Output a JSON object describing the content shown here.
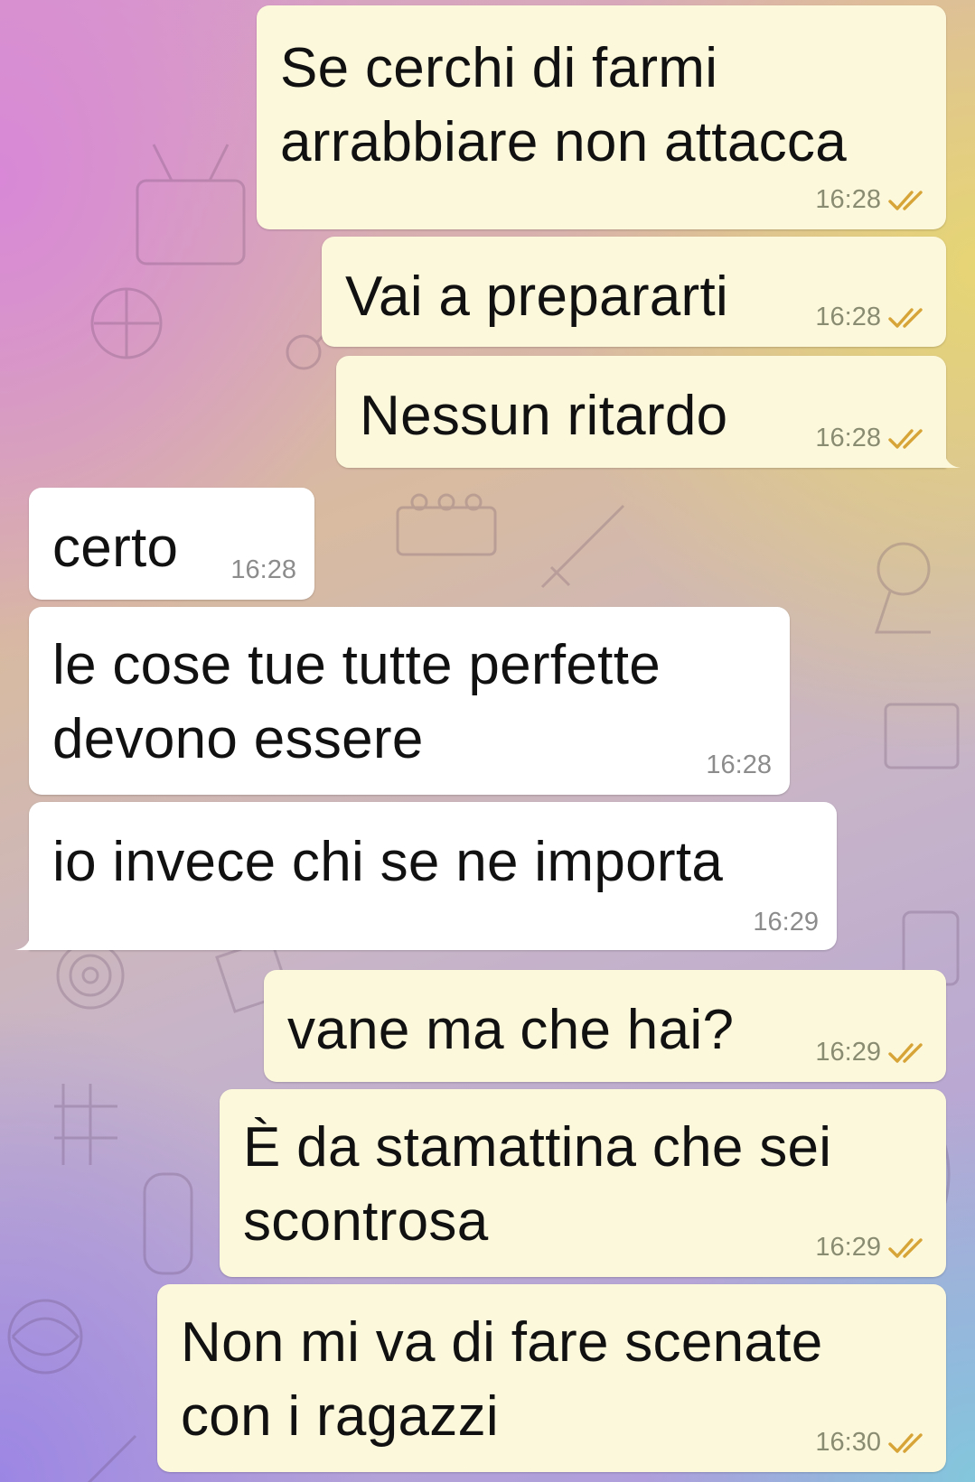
{
  "colors": {
    "outgoing_bubble": "#fcf8dc",
    "incoming_bubble": "#ffffff",
    "check_color": "#d6a437",
    "text_color": "#111111"
  },
  "icons": {
    "read_receipt": "double-check-icon"
  },
  "messages": [
    {
      "direction": "outgoing",
      "lines": [
        "Se cerchi di farmi",
        "arrabbiare non attacca"
      ],
      "time": "16:28",
      "status": "read"
    },
    {
      "direction": "outgoing",
      "lines": [
        "Vai a prepararti"
      ],
      "time": "16:28",
      "status": "read"
    },
    {
      "direction": "outgoing",
      "lines": [
        "Nessun ritardo"
      ],
      "time": "16:28",
      "status": "read"
    },
    {
      "direction": "incoming",
      "lines": [
        "certo"
      ],
      "time": "16:28"
    },
    {
      "direction": "incoming",
      "lines": [
        "le cose tue tutte perfette",
        "devono essere"
      ],
      "time": "16:28"
    },
    {
      "direction": "incoming",
      "lines": [
        "io invece chi se ne importa"
      ],
      "time": "16:29"
    },
    {
      "direction": "outgoing",
      "lines": [
        "vane ma che hai?"
      ],
      "time": "16:29",
      "status": "read"
    },
    {
      "direction": "outgoing",
      "lines": [
        "È da stamattina che sei",
        "scontrosa"
      ],
      "time": "16:29",
      "status": "read"
    },
    {
      "direction": "outgoing",
      "lines": [
        "Non mi va di fare scenate",
        "con i ragazzi"
      ],
      "time": "16:30",
      "status": "read"
    }
  ]
}
